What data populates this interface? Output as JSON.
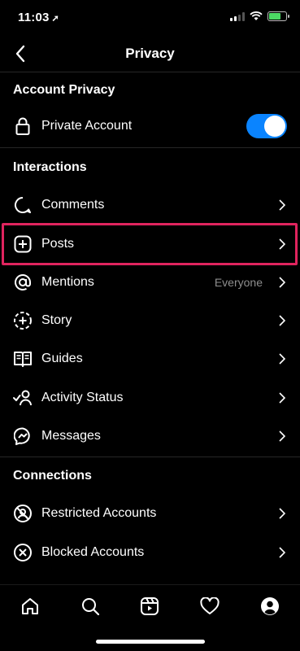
{
  "status_bar": {
    "time": "11:03",
    "location_glyph": "➚"
  },
  "header": {
    "title": "Privacy"
  },
  "sections": {
    "account_privacy": "Account Privacy",
    "interactions": "Interactions",
    "connections": "Connections"
  },
  "account": {
    "private_account_label": "Private Account",
    "private_account_enabled": true
  },
  "interactions": {
    "comments": "Comments",
    "posts": "Posts",
    "mentions": "Mentions",
    "mentions_value": "Everyone",
    "story": "Story",
    "guides": "Guides",
    "activity_status": "Activity Status",
    "messages": "Messages"
  },
  "connections": {
    "restricted": "Restricted Accounts",
    "blocked": "Blocked Accounts"
  },
  "colors": {
    "accent": "#0a84ff",
    "highlight": "#e0245e",
    "battery": "#4cd964"
  },
  "nav": [
    "home-icon",
    "search-icon",
    "reels-icon",
    "heart-icon",
    "profile-icon"
  ]
}
